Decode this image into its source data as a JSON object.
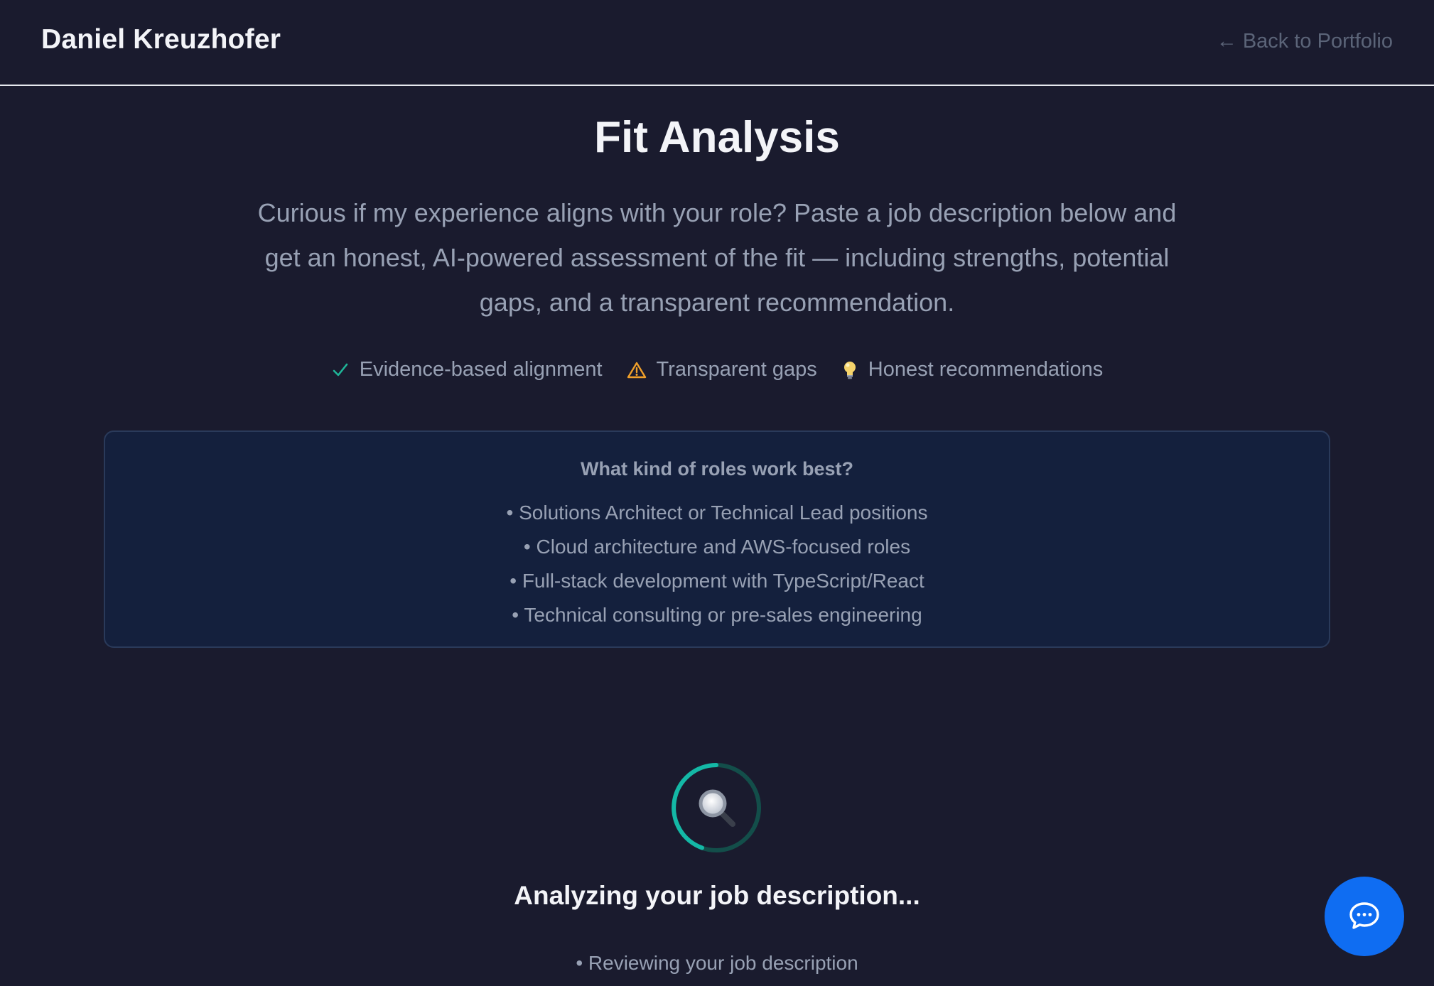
{
  "header": {
    "brand": "Daniel Kreuzhofer",
    "back_link": "← Back to Portfolio"
  },
  "main": {
    "title": "Fit Analysis",
    "intro": "Curious if my experience aligns with your role? Paste a job description below and get an honest, AI-powered assessment of the fit — including strengths, potential gaps, and a transparent recommendation.",
    "features": [
      {
        "icon": "check-icon",
        "label": "Evidence-based alignment",
        "color": "#1fb598"
      },
      {
        "icon": "warning-icon",
        "label": "Transparent gaps",
        "color": "#f0a02a"
      },
      {
        "icon": "lightbulb-icon",
        "label": "Honest recommendations",
        "color": "#f5d36b"
      }
    ]
  },
  "roles_card": {
    "heading": "What kind of roles work best?",
    "items": [
      "• Solutions Architect or Technical Lead positions",
      "• Cloud architecture and AWS-focused roles",
      "• Full-stack development with TypeScript/React",
      "• Technical consulting or pre-sales engineering"
    ]
  },
  "loading": {
    "icon": "magnifier-icon",
    "status": "Analyzing your job description...",
    "steps": [
      "• Reviewing your job description"
    ]
  },
  "chat": {
    "icon": "chat-bubble-icon",
    "color": "#0f6df2"
  },
  "colors": {
    "background": "#1a1b2e",
    "card": "#14203d",
    "accent_teal": "#14b8a6"
  }
}
